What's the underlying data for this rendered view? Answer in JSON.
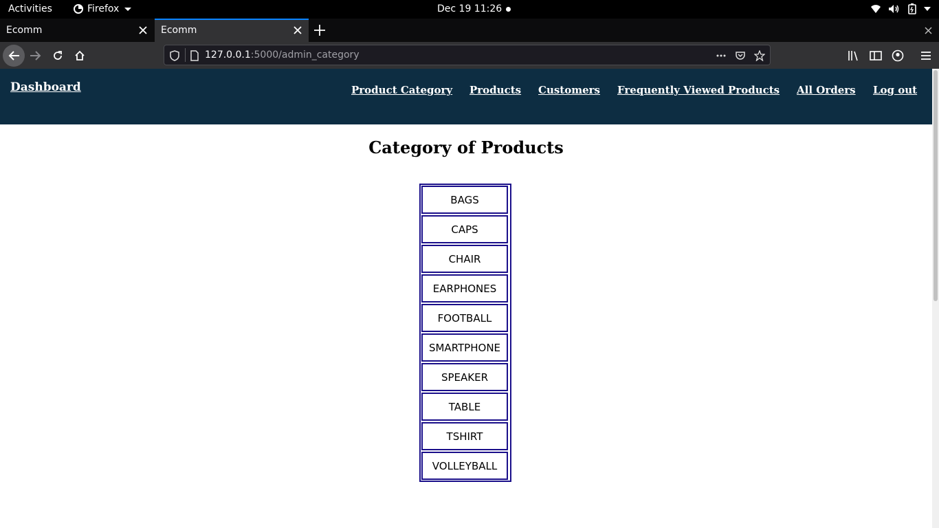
{
  "system_bar": {
    "activities": "Activities",
    "app_name": "Firefox",
    "clock": "Dec 19  11:26"
  },
  "browser": {
    "tabs": [
      {
        "title": "Ecomm",
        "active": false
      },
      {
        "title": "Ecomm",
        "active": true
      }
    ],
    "url_host": "127.0.0.1",
    "url_rest": ":5000/admin_category",
    "accent": "#0a84ff"
  },
  "site": {
    "brand": "Dashboard",
    "nav": [
      "Product Category",
      "Products",
      "Customers",
      "Frequently Viewed Products",
      "All Orders",
      "Log out"
    ],
    "header_color": "#0d2d42"
  },
  "main": {
    "title": "Category of Products",
    "categories": [
      "BAGS",
      "CAPS",
      "CHAIR",
      "EARPHONES",
      "FOOTBALL",
      "SMARTPHONE",
      "SPEAKER",
      "TABLE",
      "TSHIRT",
      "VOLLEYBALL"
    ],
    "table_border_color": "#1a0f8a"
  }
}
